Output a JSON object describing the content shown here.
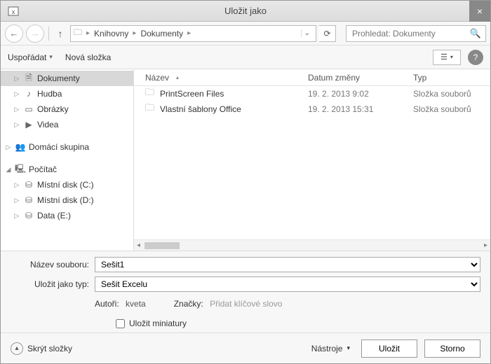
{
  "window": {
    "title": "Uložit jako"
  },
  "nav": {
    "breadcrumb": [
      "Knihovny",
      "Dokumenty"
    ],
    "refresh_tooltip": "Obnovit",
    "search_placeholder": "Prohledat: Dokumenty"
  },
  "toolbar": {
    "organize": "Uspořádat",
    "new_folder": "Nová složka"
  },
  "sidebar": {
    "libraries": [
      {
        "label": "Dokumenty",
        "icon": "document-icon",
        "selected": true
      },
      {
        "label": "Hudba",
        "icon": "music-icon"
      },
      {
        "label": "Obrázky",
        "icon": "image-icon"
      },
      {
        "label": "Videa",
        "icon": "video-icon"
      }
    ],
    "homegroup": {
      "label": "Domácí skupina"
    },
    "computer": {
      "label": "Počítač",
      "drives": [
        {
          "label": "Místní disk (C:)"
        },
        {
          "label": "Místní disk (D:)"
        },
        {
          "label": "Data (E:)"
        }
      ]
    }
  },
  "filelist": {
    "columns": {
      "name": "Název",
      "date": "Datum změny",
      "type": "Typ"
    },
    "rows": [
      {
        "name": "PrintScreen Files",
        "date": "19. 2. 2013 9:02",
        "type": "Složka souborů"
      },
      {
        "name": "Vlastní šablony Office",
        "date": "19. 2. 2013 15:31",
        "type": "Složka souborů"
      }
    ]
  },
  "form": {
    "filename_label": "Název souboru:",
    "filename_value": "Sešit1",
    "filetype_label": "Uložit jako typ:",
    "filetype_value": "Sešit Excelu",
    "authors_label": "Autoři:",
    "authors_value": "kveta",
    "tags_label": "Značky:",
    "tags_placeholder": "Přidat klíčové slovo",
    "thumbnails_label": "Uložit miniatury"
  },
  "bottom": {
    "hide_folders": "Skrýt složky",
    "tools": "Nástroje",
    "save": "Uložit",
    "cancel": "Storno"
  }
}
